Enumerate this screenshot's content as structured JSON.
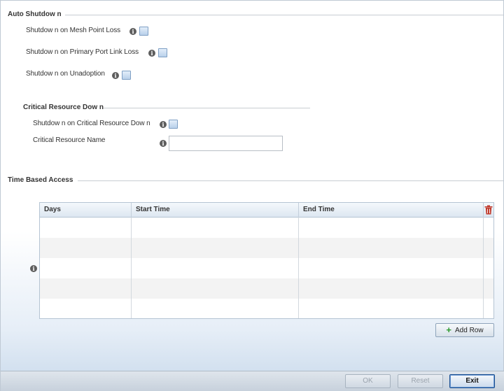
{
  "auto_shutdown": {
    "title": "Auto Shutdow n",
    "mesh_point_loss_label": "Shutdow n on Mesh Point Loss",
    "primary_port_link_loss_label": "Shutdow n on Primary Port Link Loss",
    "unadoption_label": "Shutdow n on Unadoption"
  },
  "critical_resource": {
    "title": "Critical Resource Dow n",
    "shutdown_label": "Shutdow n on Critical Resource Dow n",
    "name_label": "Critical Resource Name",
    "name_value": ""
  },
  "time_based_access": {
    "title": "Time Based Access",
    "columns": [
      "Days",
      "Start Time",
      "End Time"
    ],
    "rows": [],
    "add_row_label": "Add Row"
  },
  "footer": {
    "ok_label": "OK",
    "reset_label": "Reset",
    "exit_label": "Exit"
  },
  "icons": {
    "info": "info-icon",
    "delete": "trash-icon",
    "add": "plus-icon"
  },
  "colors": {
    "checkbox_border": "#7e9fc4",
    "delete_icon": "#c0392b",
    "add_icon": "#2b9a2b",
    "exit_border": "#1b4f91"
  }
}
